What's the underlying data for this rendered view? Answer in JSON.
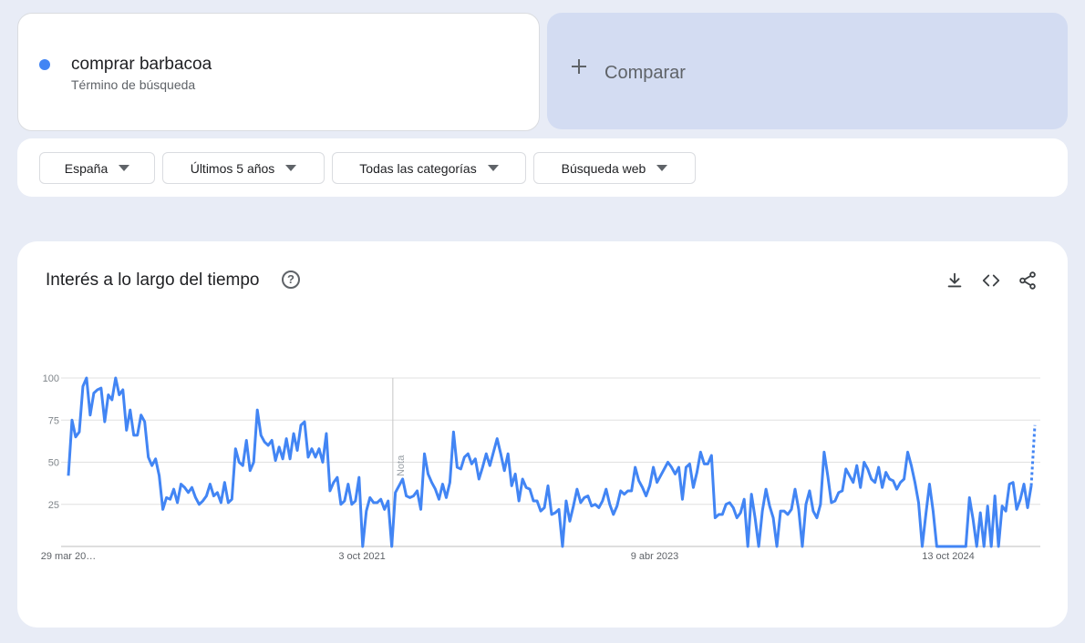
{
  "term": {
    "title": "comprar barbacoa",
    "subtitle": "Término de búsqueda",
    "color": "#4285f4"
  },
  "compare": {
    "label": "Comparar"
  },
  "filters": {
    "region": "España",
    "time": "Últimos 5 años",
    "category": "Todas las categorías",
    "search_type": "Búsqueda web"
  },
  "chart_card": {
    "title": "Interés a lo largo del tiempo",
    "help_icon": "help-icon",
    "download_icon": "download-icon",
    "embed_icon": "embed-code-icon",
    "share_icon": "share-icon"
  },
  "chart_data": {
    "type": "line",
    "title": "Interés a lo largo del tiempo",
    "xlabel": "",
    "ylabel": "",
    "ylim": [
      0,
      100
    ],
    "y_ticks": [
      "25",
      "50",
      "75",
      "100"
    ],
    "x_tick_labels": [
      "29 mar 20…",
      "3 oct 2021",
      "9 abr 2023",
      "13 oct 2024"
    ],
    "annotation": "Nota",
    "series": [
      {
        "color": "#4285f4",
        "values": [
          42,
          75,
          65,
          68,
          95,
          100,
          78,
          91,
          93,
          94,
          74,
          90,
          87,
          100,
          90,
          93,
          69,
          81,
          66,
          66,
          78,
          74,
          53,
          48,
          52,
          42,
          22,
          29,
          28,
          34,
          26,
          37,
          35,
          32,
          35,
          29,
          25,
          27,
          30,
          37,
          30,
          32,
          26,
          38,
          26,
          28,
          58,
          50,
          48,
          63,
          45,
          50,
          81,
          66,
          62,
          60,
          63,
          51,
          59,
          52,
          64,
          52,
          67,
          57,
          72,
          74,
          53,
          58,
          53,
          58,
          50,
          67,
          33,
          38,
          41,
          25,
          27,
          37,
          25,
          27,
          41,
          0,
          21,
          29,
          26,
          26,
          28,
          22,
          27,
          0,
          32,
          36,
          40,
          30,
          29,
          30,
          33,
          22,
          55,
          43,
          38,
          34,
          28,
          37,
          29,
          38,
          68,
          47,
          46,
          53,
          55,
          49,
          52,
          40,
          47,
          55,
          48,
          56,
          64,
          55,
          45,
          55,
          36,
          43,
          27,
          40,
          35,
          34,
          27,
          27,
          21,
          23,
          36,
          19,
          20,
          22,
          0,
          27,
          15,
          24,
          34,
          26,
          29,
          30,
          24,
          25,
          23,
          27,
          34,
          25,
          19,
          24,
          33,
          31,
          33,
          33,
          47,
          39,
          35,
          30,
          36,
          47,
          38,
          42,
          46,
          50,
          47,
          43,
          47,
          28,
          47,
          49,
          35,
          44,
          56,
          49,
          49,
          54,
          17,
          19,
          19,
          25,
          26,
          23,
          17,
          20,
          28,
          0,
          31,
          17,
          0,
          21,
          34,
          24,
          17,
          0,
          21,
          21,
          19,
          22,
          34,
          22,
          0,
          25,
          33,
          21,
          17,
          25,
          56,
          42,
          26,
          27,
          32,
          33,
          46,
          42,
          38,
          48,
          35,
          50,
          46,
          40,
          38,
          47,
          35,
          44,
          40,
          39,
          34,
          38,
          40,
          56,
          48,
          38,
          26,
          0,
          19,
          37,
          21,
          0,
          0,
          0,
          0,
          0,
          0,
          0,
          0,
          0,
          29,
          16,
          0,
          20,
          0,
          24,
          0,
          30,
          0,
          24,
          21,
          37,
          38,
          22,
          28,
          37,
          23,
          36
        ],
        "forecast_values": [
          36,
          72
        ]
      }
    ]
  }
}
